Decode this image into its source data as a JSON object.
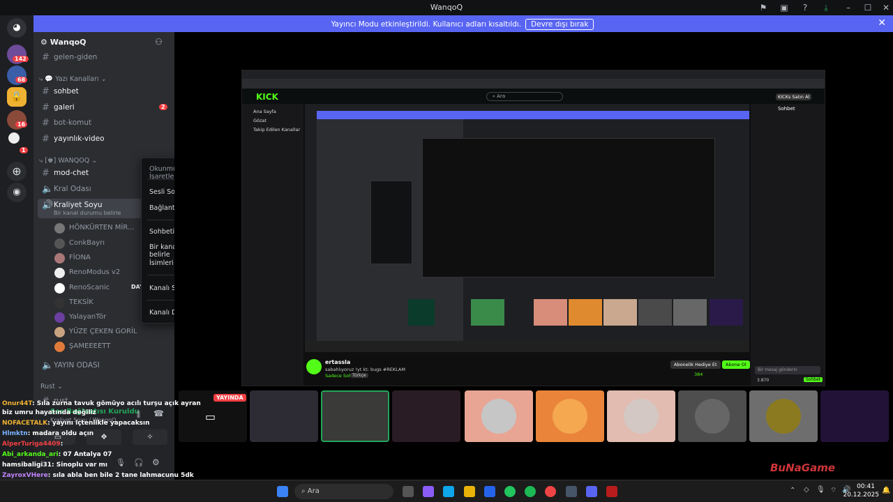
{
  "window": {
    "title": "WanqoQ"
  },
  "notice": {
    "message": "Yayıncı Modu etkinleştirildi. Kullanıcı adları kısaltıldı.",
    "button": "Devre dışı bırak"
  },
  "guilds": {
    "badge1": "142",
    "badge2": "68",
    "badge3": "16",
    "badge4": "1"
  },
  "server": {
    "name": "WanqoQ"
  },
  "channels": {
    "gelen_giden": "gelen-giden",
    "cat_text": "Yazı Kanalları",
    "sohbet": "sohbet",
    "galeri": "galeri",
    "galeri_badge": "2",
    "bot_komut": "bot-komut",
    "yayinlik_video": "yayınlık-video",
    "cat_wanqoq": "WANQOQ",
    "mod_chet": "mod-chet",
    "kral_odasi": "Kral Odası",
    "kraliyet_soyu": "Kraliyet Soyu",
    "status_hint": "Bir kanal durumu belirle",
    "yayin_odasi": "YAYIN ODASI",
    "cat_rust": "Rust",
    "rust_ch": "rust"
  },
  "voice_users": [
    "HÖNKÜRTEN MİR...",
    "ConkBayrı",
    "FİONA",
    "RenoModus v2",
    "ReпоSсапіс",
    "TEKSİK",
    "YalayanTör",
    "YÜZE ÇEKEN GORİL",
    "ŞAMEEEETT"
  ],
  "voice_user_tag": "DAYI",
  "context_menu": {
    "mark_read": "Okunmuş Olarak İşaretle",
    "invite": "Sesli Sohbete Davet et",
    "copy_link": "Bağlantıyı Kopyala",
    "open_chat": "Sohbeti Aç",
    "set_status": "Bir kanal durumu belirle",
    "hide_names": "İsimleri Gizle",
    "mute": "Kanalı Sustur",
    "edit": "Kanalı Düzenle"
  },
  "voice_panel": {
    "connected": "Ses Bağlantısı Kuruldu",
    "channel": "Kraliyet Soyu / WanqoQ"
  },
  "stream_badge": "YAYINDA",
  "chat_overlay": [
    {
      "user": "Onur44T",
      "text": ": Sıla zurna tavuk gömüyo acılı turşu açık ayran"
    },
    {
      "user": "",
      "text": "biz umru hayatında değiliz"
    },
    {
      "user": "NOFACETALK",
      "text": ": yayını içtenlikle yapacaksın"
    },
    {
      "user": "Hlmktn",
      "text": ": madara oldu açın"
    },
    {
      "user": "AlperTuriga4409",
      "text": ":"
    },
    {
      "user": "Abi_arkanda_ari",
      "text": ": 07 Antalya 07"
    },
    {
      "user": "hamsibaligi31",
      "text": ": Sinoplu var mı"
    },
    {
      "user": "ZayroxVHere",
      "text": ": sıla abla ben bile 2 tane lahmacunu 5dk"
    }
  ],
  "kick": {
    "streamer": "ertassla",
    "stream_title": "sabahlıyoruz !yt kt: bugs #REKLAM",
    "category": "Sadece Sohbet",
    "tag": "Türkçe",
    "viewers": "384",
    "follow": "Abonelik Hediye Et",
    "sub": "Abone Ol",
    "chat_title": "Sohbet",
    "chat_input": "Bir mesaj gönderin",
    "chat_send": "Sohbet",
    "search": "Ara",
    "nav_home": "Ana Sayfa",
    "nav_browse": "Gözat",
    "nav_following": "Takip Edilen Kanallar",
    "buy": "KICKs Satın Al",
    "follow_count": "3.870"
  },
  "taskbar": {
    "search": "Ara",
    "time": "00:41",
    "date": "20.12.2025"
  },
  "watermark": "BuNaGame"
}
